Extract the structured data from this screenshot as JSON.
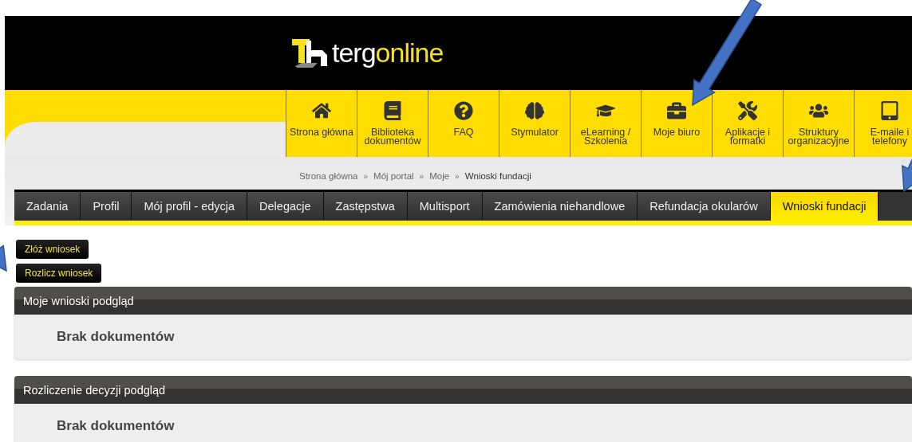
{
  "logo": {
    "parts": [
      "terg",
      "online"
    ]
  },
  "nav": [
    {
      "label": "Strona główna"
    },
    {
      "label": "Biblioteka dokumentów"
    },
    {
      "label": "FAQ"
    },
    {
      "label": "Stymulator"
    },
    {
      "label": "eLearning / Szkolenia"
    },
    {
      "label": "Moje biuro"
    },
    {
      "label": "Aplikacje i formatki"
    },
    {
      "label": "Struktury organizacyjne"
    },
    {
      "label": "E-maile i telefony"
    }
  ],
  "breadcrumb": [
    "Strona główna",
    "Mój portal",
    "Moje",
    "Wnioski fundacji"
  ],
  "breadcrumb_separator": "»",
  "tabs": [
    {
      "label": "Zadania",
      "selected": false
    },
    {
      "label": "Profil",
      "selected": false
    },
    {
      "label": "Mój profil - edycja",
      "selected": false
    },
    {
      "label": "Delegacje",
      "selected": false
    },
    {
      "label": "Zastępstwa",
      "selected": false
    },
    {
      "label": "Multisport",
      "selected": false
    },
    {
      "label": "Zamówienia niehandlowe",
      "selected": false
    },
    {
      "label": "Refundacja okularów",
      "selected": false
    },
    {
      "label": "Wnioski fundacji",
      "selected": true
    }
  ],
  "buttons": [
    "Złóż wniosek",
    "Rozlicz wniosek"
  ],
  "panels": [
    {
      "title": "Moje wnioski podgląd",
      "message": "Brak dokumentów"
    },
    {
      "title": "Rozliczenie decyzji podgląd",
      "message": "Brak dokumentów"
    }
  ]
}
